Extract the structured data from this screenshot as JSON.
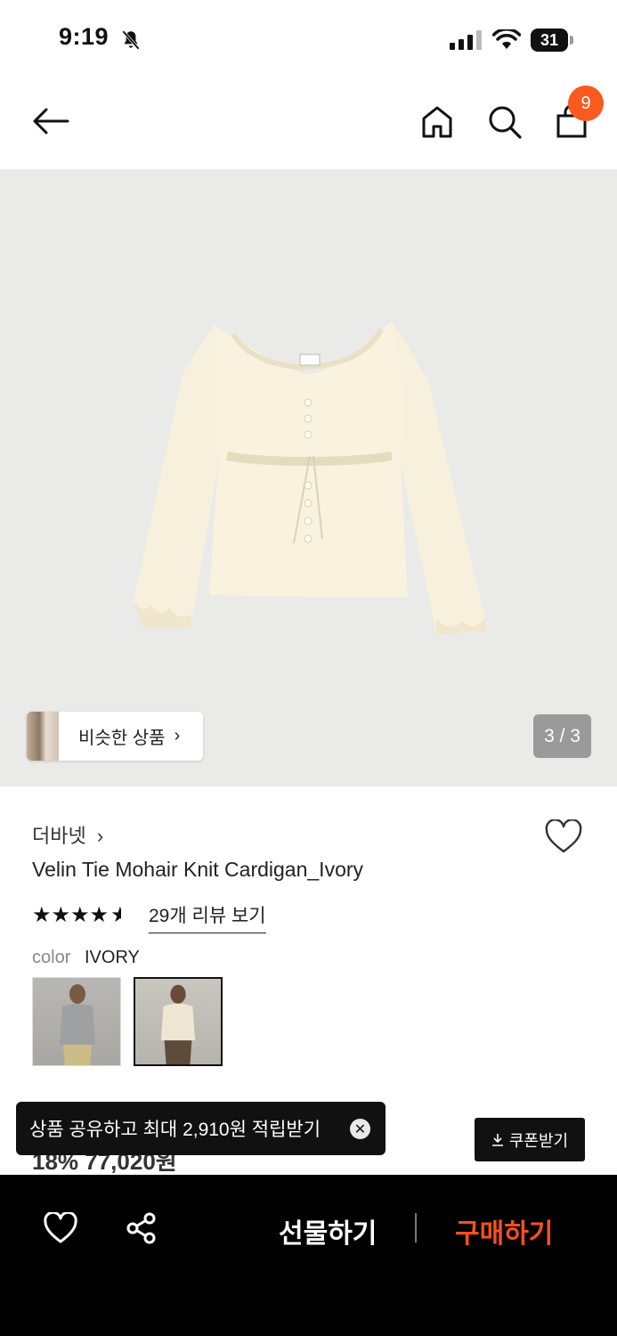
{
  "status_bar": {
    "time": "9:19",
    "battery": "31"
  },
  "header": {
    "cart_count": "9"
  },
  "gallery": {
    "pager": "3 / 3",
    "similar_label": "비슷한 상품",
    "chevron": "›"
  },
  "product": {
    "brand": "더바넷",
    "brand_chevron": "›",
    "title": "Velin Tie Mohair Knit Cardigan_Ivory",
    "rating_stars": "★★★★",
    "rating": 4.5,
    "review_link": "29개 리뷰 보기",
    "color_label": "color",
    "color_value": "IVORY",
    "price_partial": "18% 77,020원"
  },
  "toast": {
    "message": "상품 공유하고 최대 2,910원 적립받기",
    "close": "✕"
  },
  "coupon": {
    "label": "쿠폰받기",
    "icon": "download-icon"
  },
  "bottom_bar": {
    "gift_label": "선물하기",
    "buy_label": "구매하기"
  },
  "colors": {
    "accent": "#fa5a1e",
    "buy": "#f5501e"
  }
}
